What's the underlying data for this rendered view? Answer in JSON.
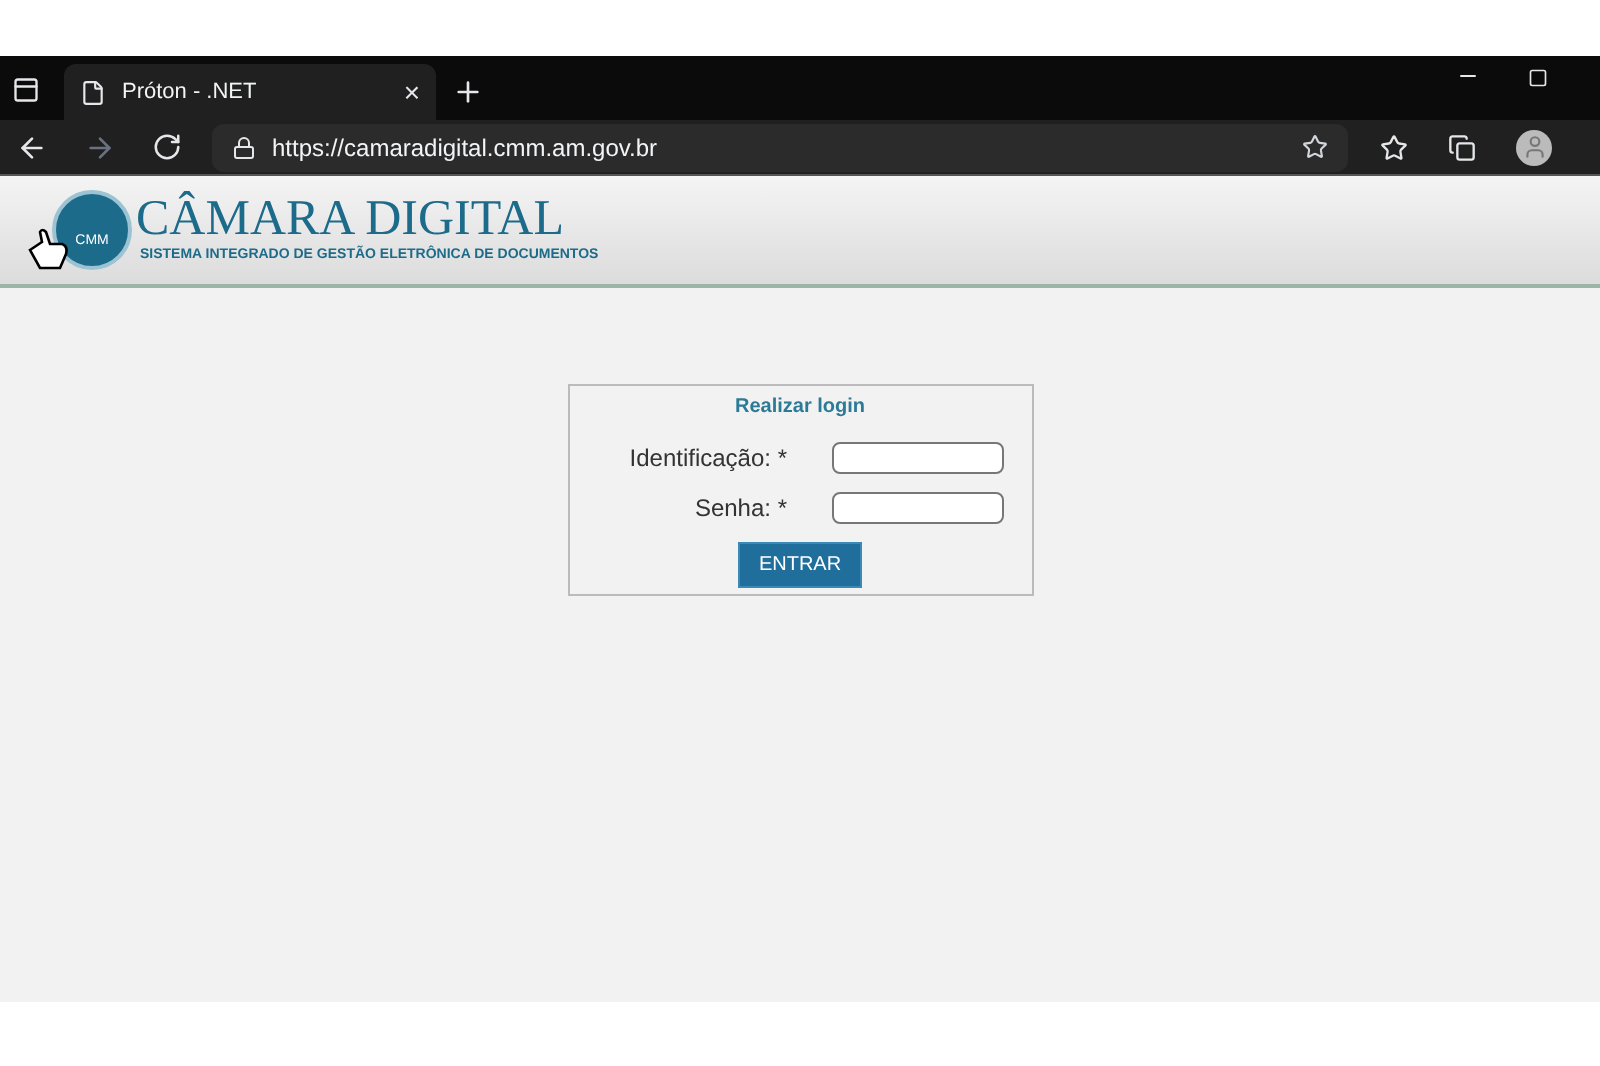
{
  "browser": {
    "tab": {
      "title": "Próton - .NET",
      "close": "×"
    },
    "url": "https://camaradigital.cmm.am.gov.br"
  },
  "header": {
    "logo_mark": "CMM",
    "title": "CÂMARA DIGITAL",
    "subtitle": "SISTEMA INTEGRADO DE GESTÃO ELETRÔNICA DE DOCUMENTOS"
  },
  "login": {
    "title": "Realizar login",
    "fields": [
      {
        "label": "Identificação: *"
      },
      {
        "label": "Senha: *"
      }
    ],
    "button": "ENTRAR"
  }
}
